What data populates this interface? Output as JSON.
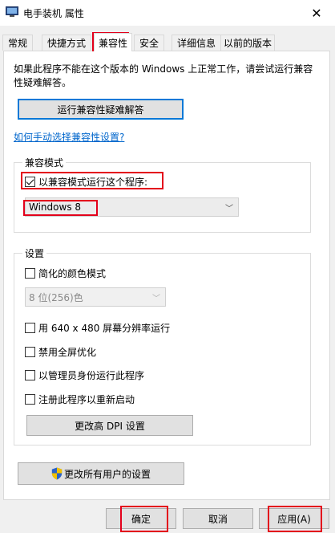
{
  "window": {
    "title": "电手装机  属性"
  },
  "tabs": [
    "常规",
    "快捷方式",
    "兼容性",
    "安全",
    "详细信息",
    "以前的版本"
  ],
  "intro": "如果此程序不能在这个版本的 Windows 上正常工作，请尝试运行兼容性疑难解答。",
  "troubleshoot_button": "运行兼容性疑难解答",
  "manual_link": "如何手动选择兼容性设置?",
  "compat_mode": {
    "title": "兼容模式",
    "checkbox_label": "以兼容模式运行这个程序:",
    "checked": true,
    "selected_os": "Windows 8"
  },
  "settings": {
    "title": "设置",
    "reduced_color_label": "简化的颜色模式",
    "color_select": "8 位(256)色",
    "res_label": "用 640 x 480 屏幕分辨率运行",
    "fullscreen_label": "禁用全屏优化",
    "admin_label": "以管理员身份运行此程序",
    "restart_label": "注册此程序以重新启动",
    "dpi_button": "更改高 DPI 设置"
  },
  "all_users_button": "更改所有用户的设置",
  "footer": {
    "ok": "确定",
    "cancel": "取消",
    "apply": "应用(A)"
  }
}
